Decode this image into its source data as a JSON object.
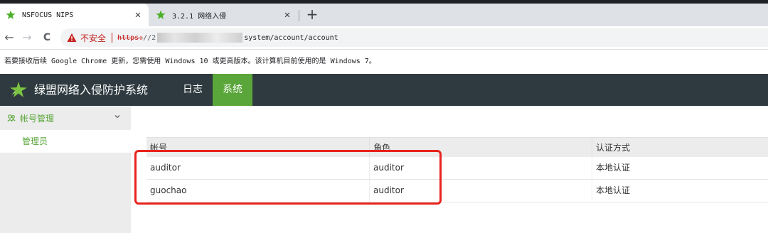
{
  "browser": {
    "tabs": [
      {
        "title": "NSFOCUS NIPS",
        "active": true
      },
      {
        "title": "3.2.1 网络入侵",
        "active": false
      }
    ],
    "close_glyph": "✕",
    "new_tab_glyph": "+",
    "nav": {
      "back": "←",
      "forward": "→",
      "reload": "C"
    },
    "address": {
      "security_label": "不安全",
      "scheme": "https:",
      "host_prefix": "//2",
      "path": "system/account/account"
    },
    "infobar_text": "若要接收后续 Google Chrome 更新，您需使用 Windows 10 或更高版本。该计算机目前使用的是 Windows 7。"
  },
  "app": {
    "title": "绿盟网络入侵防护系统",
    "nav": [
      {
        "label": "日志",
        "active": false
      },
      {
        "label": "系统",
        "active": true
      }
    ],
    "accent_color": "#5aa63a",
    "header_color": "#2e3a3f"
  },
  "sidebar": {
    "group_label": "帐号管理",
    "items": [
      {
        "label": "管理员",
        "selected": true
      }
    ]
  },
  "table": {
    "columns": [
      "帐号",
      "角色",
      "认证方式"
    ],
    "rows": [
      [
        "auditor",
        "auditor",
        "本地认证"
      ],
      [
        "guochao",
        "auditor",
        "本地认证"
      ]
    ]
  },
  "annotation": {
    "color": "#e8231d"
  }
}
